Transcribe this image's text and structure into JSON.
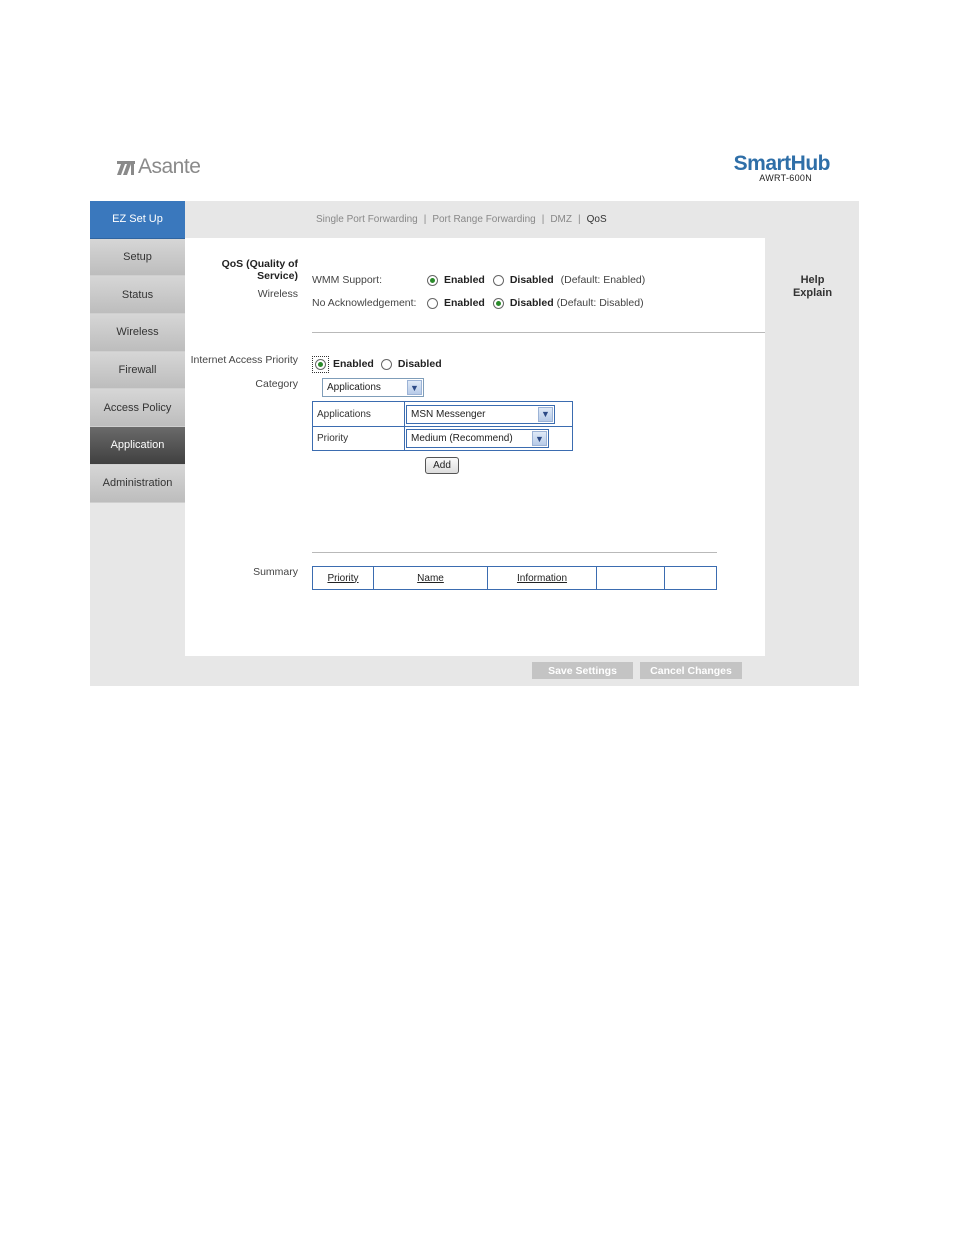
{
  "brand": {
    "name": "Asante"
  },
  "product": {
    "name": "SmartHub",
    "model": "AWRT-600N"
  },
  "sidebar": {
    "items": [
      {
        "label": "EZ Set Up"
      },
      {
        "label": "Setup"
      },
      {
        "label": "Status"
      },
      {
        "label": "Wireless"
      },
      {
        "label": "Firewall"
      },
      {
        "label": "Access Policy"
      },
      {
        "label": "Application"
      },
      {
        "label": "Administration"
      }
    ]
  },
  "subnav": {
    "items": [
      "Single Port Forwarding",
      "Port Range Forwarding",
      "DMZ",
      "QoS"
    ],
    "separator": "|"
  },
  "qos": {
    "section_title": "QoS (Quality of Service)",
    "wireless_label": "Wireless",
    "wmm_label": "WMM Support:",
    "wmm_enabled": "Enabled",
    "wmm_disabled": "Disabled",
    "wmm_default": "(Default: Enabled)",
    "noack_label": "No Acknowledgement:",
    "noack_enabled": "Enabled",
    "noack_disabled": "Disabled",
    "noack_default": "(Default: Disabled)"
  },
  "internet_priority": {
    "label": "Internet Access Priority",
    "enabled": "Enabled",
    "disabled": "Disabled",
    "category_label": "Category",
    "category_value": "Applications",
    "applications_label": "Applications",
    "applications_value": "MSN Messenger",
    "priority_label": "Priority",
    "priority_value": "Medium (Recommend)",
    "add_button": "Add"
  },
  "summary": {
    "label": "Summary",
    "columns": [
      "Priority",
      "Name",
      "Information",
      "",
      ""
    ]
  },
  "help": {
    "line1": "Help",
    "line2": "Explain"
  },
  "actions": {
    "save": "Save Settings",
    "cancel": "Cancel Changes"
  }
}
